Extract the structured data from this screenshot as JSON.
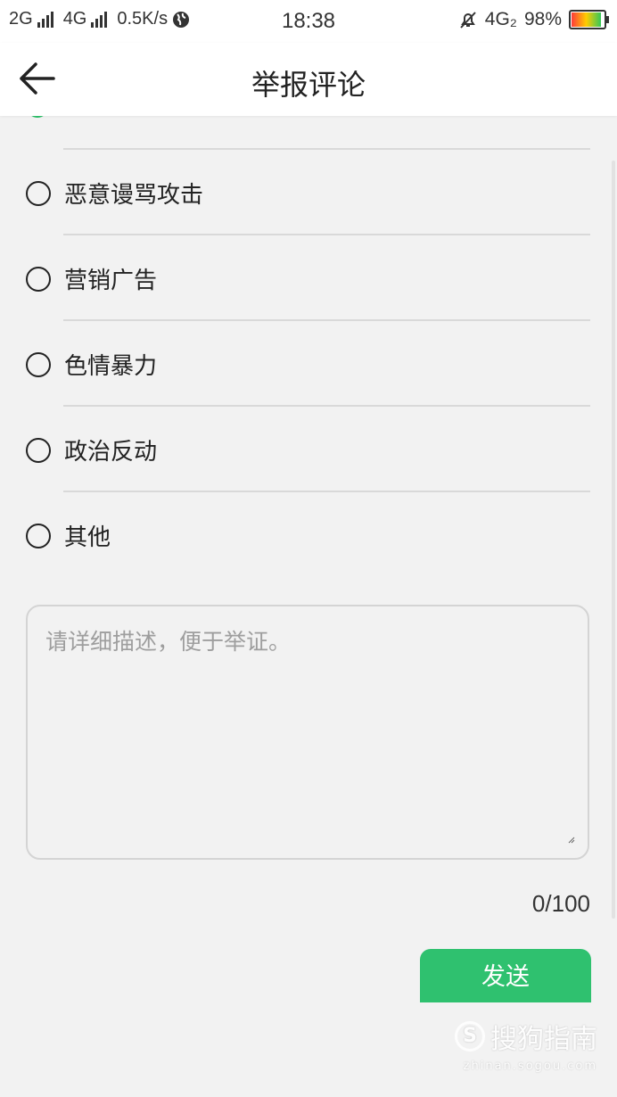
{
  "status_bar": {
    "net1": "2G",
    "net2": "4G",
    "speed": "0.5K/s",
    "time": "18:38",
    "net3": "4G₂",
    "battery": "98%"
  },
  "header": {
    "title": "举报评论"
  },
  "options": [
    {
      "label": "恶意谩骂攻击"
    },
    {
      "label": "营销广告"
    },
    {
      "label": "色情暴力"
    },
    {
      "label": "政治反动"
    },
    {
      "label": "其他"
    }
  ],
  "description": {
    "placeholder": "请详细描述，便于举证。",
    "counter": "0/100"
  },
  "send_label": "发送",
  "watermark": {
    "brand": "搜狗指南",
    "domain": "zhinan.sogou.com"
  },
  "colors": {
    "accent": "#2fc16f"
  }
}
